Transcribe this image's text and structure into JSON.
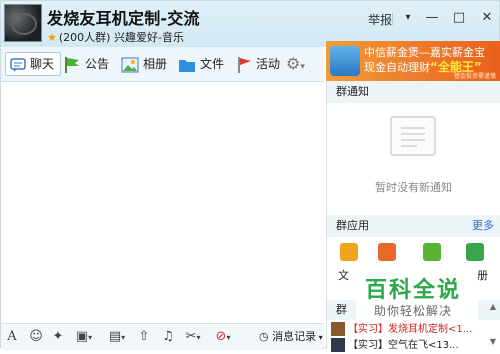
{
  "header": {
    "title": "发烧友耳机定制-交流",
    "group_size": "(200人群)",
    "group_category": "兴趣爱好-音乐",
    "report_label": "举报"
  },
  "window_buttons": {
    "dropdown": "▾",
    "minimize": "—",
    "maximize": "□",
    "close": "✕"
  },
  "tabs": [
    {
      "label": "聊天",
      "icon": "chat-icon"
    },
    {
      "label": "公告",
      "icon": "flag-icon"
    },
    {
      "label": "相册",
      "icon": "picture-icon"
    },
    {
      "label": "文件",
      "icon": "folder-icon"
    },
    {
      "label": "活动",
      "icon": "red-flag-icon"
    }
  ],
  "ad": {
    "line1": "中信薪金煲—嘉实薪金宝",
    "line2_prefix": "现金自动理财",
    "line2_highlight": "“全能王”",
    "line3": "基金投资需谨慎"
  },
  "input_toolbar": {
    "history_label": "消息记录"
  },
  "right_panel": {
    "notice_title": "群通知",
    "notice_empty": "暂时没有新通知",
    "apps_title": "群应用",
    "apps_more": "更多",
    "app_labels": [
      "文",
      "册"
    ],
    "members_title": "群",
    "members": [
      {
        "text": "【实习】发烧耳机定制<1..."
      },
      {
        "text": "【实习】空气在飞<13..."
      }
    ]
  },
  "watermark": {
    "title": "百科全说",
    "subtitle": "助你轻松解决"
  },
  "colors": {
    "header_bg": "#d2e9f4",
    "toolbar_bg": "#eef6fb",
    "ad_orange": "#e9601c",
    "watermark_green": "#2aa84a",
    "member_red": "#d0271d"
  }
}
